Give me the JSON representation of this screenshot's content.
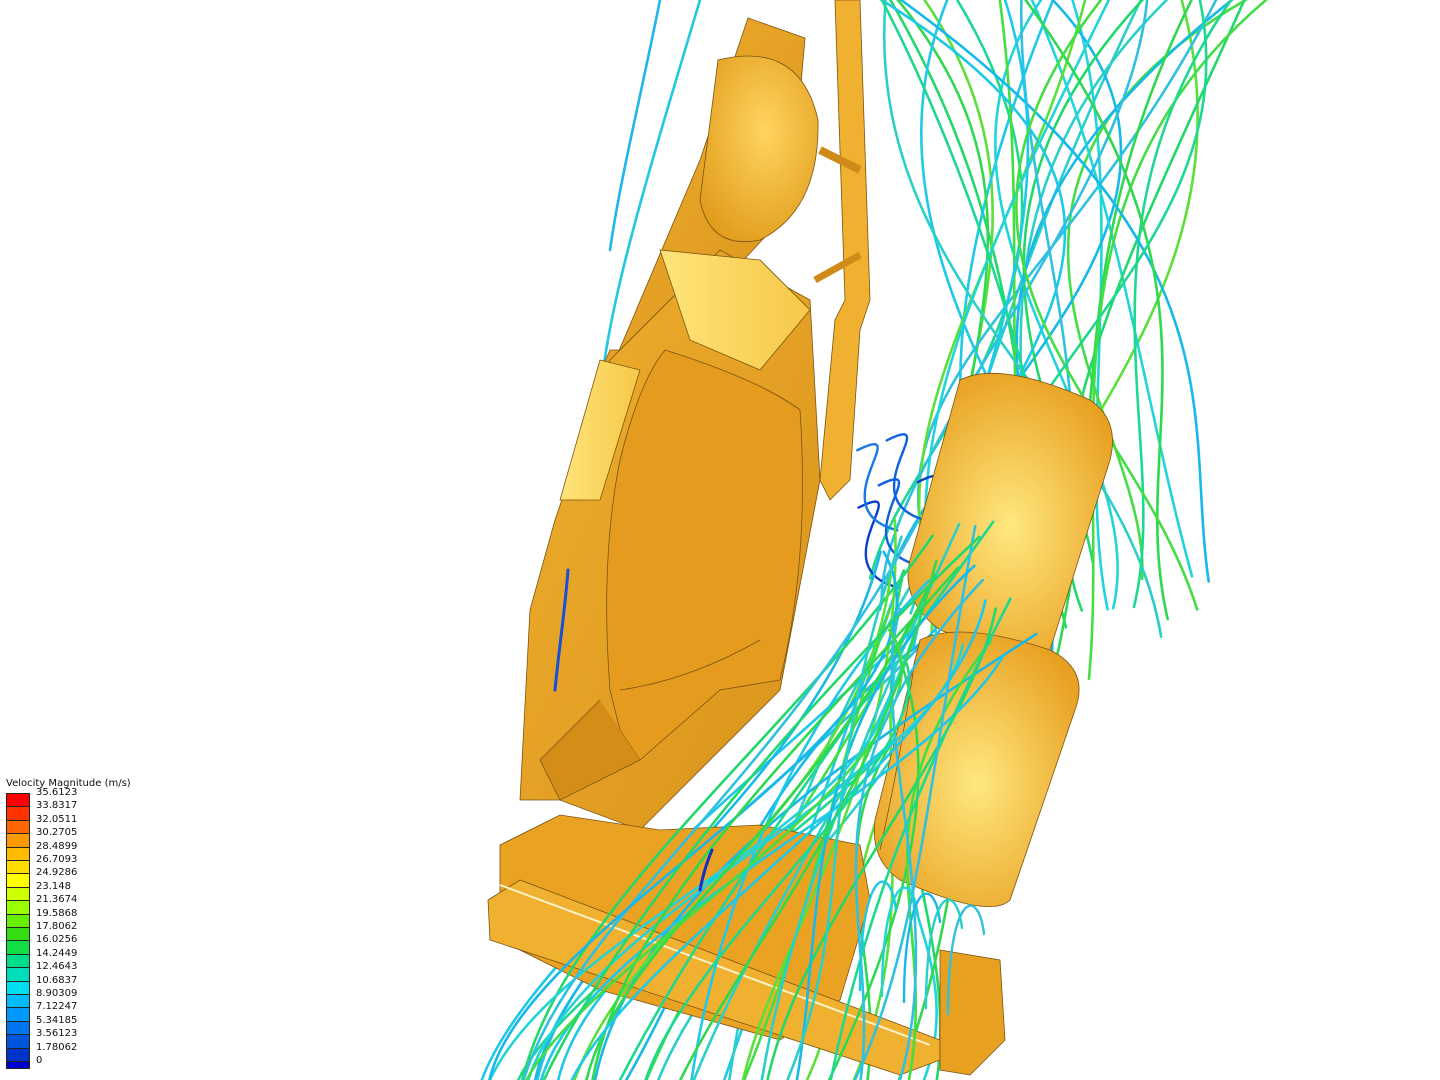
{
  "legend": {
    "title": "Velocity Magnitude (m/s)",
    "entries": [
      {
        "label": "35.6123",
        "color": "#ff0000"
      },
      {
        "label": "33.8317",
        "color": "#ff3300"
      },
      {
        "label": "32.0511",
        "color": "#ff6600"
      },
      {
        "label": "30.2705",
        "color": "#ff9900"
      },
      {
        "label": "28.4899",
        "color": "#ffbb00"
      },
      {
        "label": "26.7093",
        "color": "#ffdd00"
      },
      {
        "label": "24.9286",
        "color": "#ffff00"
      },
      {
        "label": "23.148",
        "color": "#ccff00"
      },
      {
        "label": "21.3674",
        "color": "#99ff00"
      },
      {
        "label": "19.5868",
        "color": "#66ee00"
      },
      {
        "label": "17.8062",
        "color": "#33dd11"
      },
      {
        "label": "16.0256",
        "color": "#11dd44"
      },
      {
        "label": "14.2449",
        "color": "#00dd88"
      },
      {
        "label": "12.4643",
        "color": "#00ddbb"
      },
      {
        "label": "10.6837",
        "color": "#00ddee"
      },
      {
        "label": "8.90309",
        "color": "#00bbff"
      },
      {
        "label": "7.12247",
        "color": "#0099ff"
      },
      {
        "label": "5.34185",
        "color": "#0077ee"
      },
      {
        "label": "3.56123",
        "color": "#0055dd"
      },
      {
        "label": "1.78062",
        "color": "#0033cc"
      },
      {
        "label": "0",
        "color": "#0000cc"
      }
    ]
  },
  "scene": {
    "body_color": "#e8a020",
    "body_highlight": "#ffe27a",
    "body_edge": "#6b4a10"
  }
}
